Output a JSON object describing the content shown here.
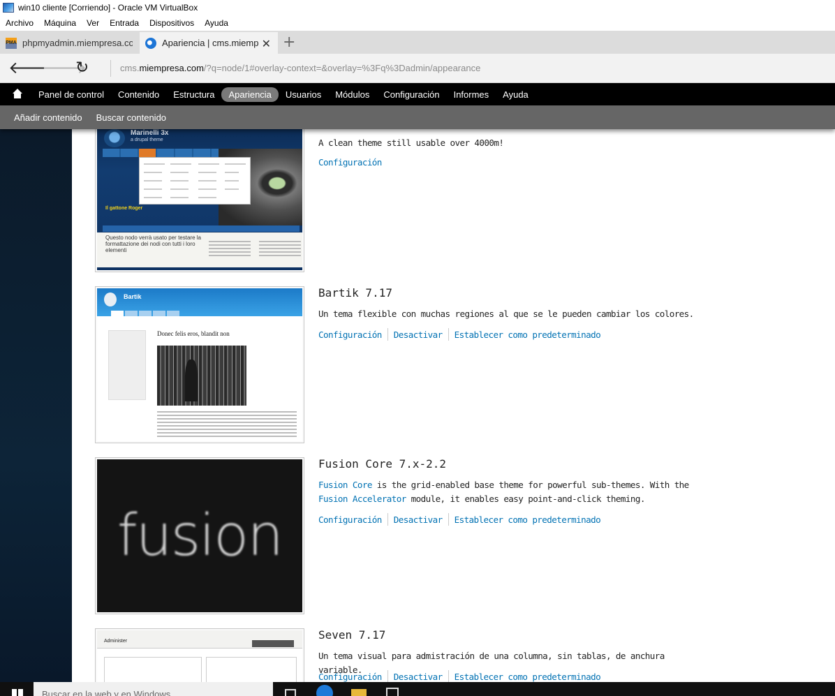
{
  "vbox": {
    "title": "win10 cliente [Corriendo] - Oracle VM VirtualBox",
    "menu": [
      "Archivo",
      "Máquina",
      "Ver",
      "Entrada",
      "Dispositivos",
      "Ayuda"
    ]
  },
  "browser": {
    "tabs": [
      {
        "label": "phpmyadmin.miempresa.cor",
        "icon": "phpmyadmin-icon"
      },
      {
        "label": "Apariencia | cms.miemp",
        "icon": "edge-icon"
      }
    ],
    "close_glyph": "✕",
    "new_tab_glyph": "+",
    "url_host_prefix": "cms.",
    "url_domain": "miempresa.com",
    "url_path": "/?q=node/1#overlay-context=&overlay=%3Fq%3Dadmin/appearance"
  },
  "drupal": {
    "toolbar": [
      "Panel de control",
      "Contenido",
      "Estructura",
      "Apariencia",
      "Usuarios",
      "Módulos",
      "Configuración",
      "Informes",
      "Ayuda"
    ],
    "active_item": "Apariencia",
    "shortcuts": [
      "Añadir contenido",
      "Buscar contenido"
    ]
  },
  "themes": [
    {
      "name": "",
      "description": "A clean theme still usable over 4000m!",
      "actions": [
        "Configuración"
      ],
      "screenshot": {
        "title": "Marinelli 3x",
        "subtitle": "a drupal theme",
        "caption": "Il gattone Roger",
        "body_text": "Questo nodo verrà usato per testare la formattazione dei nodi con tutti i loro elementi"
      }
    },
    {
      "name": "Bartik 7.17",
      "description": "Un tema flexible con muchas regiones al que se le pueden cambiar los colores.",
      "actions": [
        "Configuración",
        "Desactivar",
        "Establecer como predeterminado"
      ],
      "screenshot": {
        "title": "Bartik",
        "headline": "Donec felis eros, blandit non"
      }
    },
    {
      "name": "Fusion Core 7.x-2.2",
      "description_parts": {
        "link1": "Fusion Core",
        "text1": " is the grid-enabled base theme for powerful sub-themes. With the ",
        "link2": "Fusion Accelerator",
        "text2": " module, it enables easy point-and-click theming."
      },
      "actions": [
        "Configuración",
        "Desactivar",
        "Establecer como predeterminado"
      ],
      "screenshot": {
        "word": "fusion"
      }
    },
    {
      "name": "Seven 7.17",
      "description": "Un tema visual para admistración de una columna, sin tablas, de anchura variable.",
      "actions": [
        "Configuración",
        "Desactivar",
        "Establecer como predeterminado"
      ],
      "screenshot": {
        "title": "Administer"
      }
    }
  ],
  "taskbar": {
    "search_placeholder": "Buscar en la web y en Windows"
  },
  "colors": {
    "link": "#0071b3",
    "toolbar_bg": "#000000",
    "shortcut_bg": "#666666",
    "active_pill": "#7a7a7a"
  }
}
